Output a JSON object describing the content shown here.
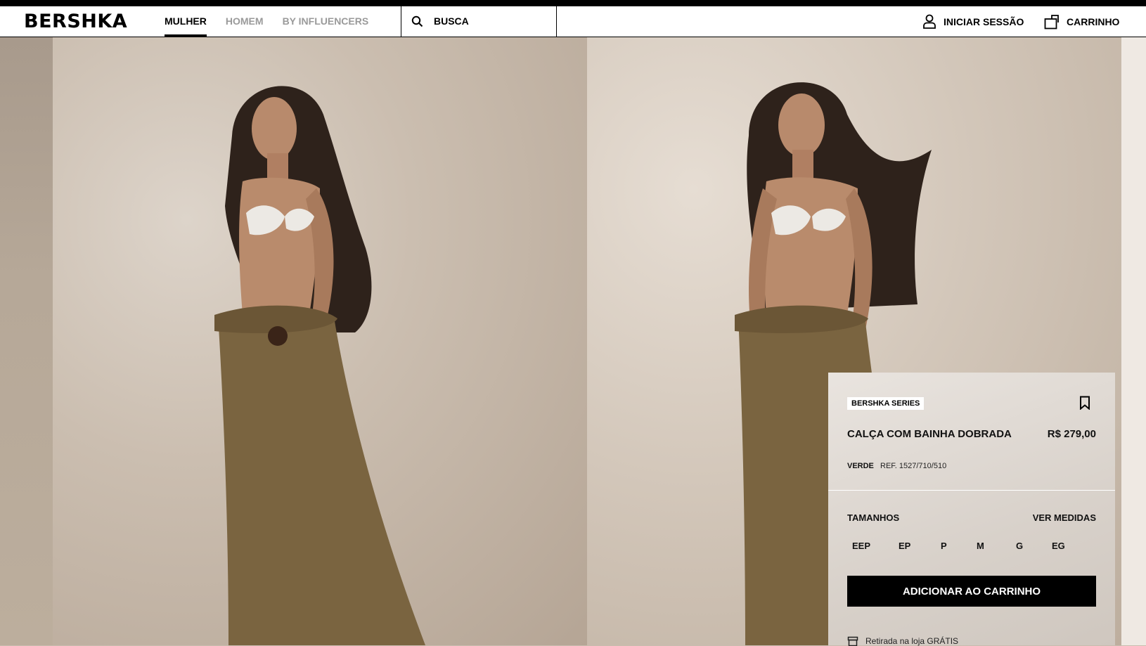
{
  "header": {
    "logo": "BERSHKA",
    "nav": [
      {
        "label": "MULHER",
        "active": true
      },
      {
        "label": "HOMEM",
        "active": false
      },
      {
        "label": "BY INFLUENCERS",
        "active": false
      }
    ],
    "search_label": "BUSCA",
    "login_label": "INICIAR SESSÃO",
    "cart_label": "CARRINHO"
  },
  "product": {
    "badge": "BERSHKA SERIES",
    "name": "CALÇA COM BAINHA DOBRADA",
    "price": "R$ 279,00",
    "color": "VERDE",
    "ref": "REF. 1527/710/510",
    "sizes_title": "TAMANHOS",
    "measures_label": "VER MEDIDAS",
    "sizes": [
      "EEP",
      "EP",
      "P",
      "M",
      "G",
      "EG"
    ],
    "add_to_cart": "ADICIONAR AO CARRINHO",
    "pickup": "Retirada na loja GRÁTIS"
  },
  "colors": {
    "accent": "#000000",
    "pants": "#7a6440",
    "background_wall": "#cbbeb0"
  }
}
